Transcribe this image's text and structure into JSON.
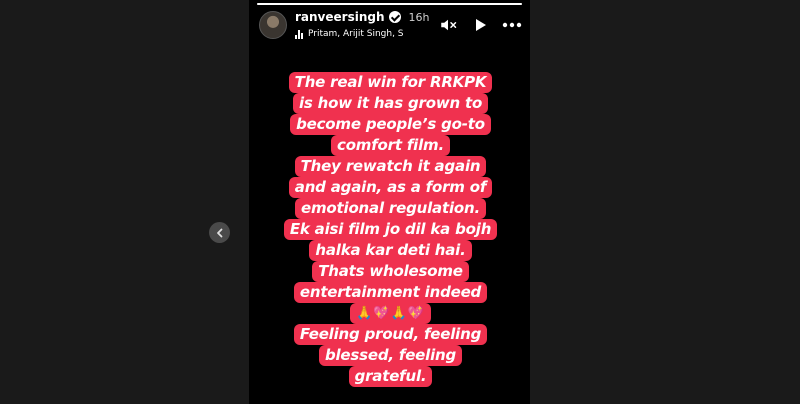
{
  "story": {
    "username": "ranveersingh",
    "time_ago": "16h",
    "music": "Pritam, Arijit Singh, S",
    "progress": 1.0,
    "text_lines": [
      "The real win for RRKPK",
      "is how it has grown to",
      "become people’s go-to",
      "comfort film.",
      "They rewatch it again",
      "and again, as a form of",
      "emotional regulation.",
      "Ek aisi film jo dil ka bojh",
      "halka kar deti hai.",
      "Thats wholesome",
      "entertainment indeed",
      "🙏💖🙏💖",
      "Feeling proud, feeling",
      "blessed, feeling",
      "grateful."
    ],
    "highlight_color": "#f0314f"
  },
  "icons": {
    "verified": "verified-badge-icon",
    "mute": "mute-icon",
    "play": "play-icon",
    "more": "more-options-icon",
    "prev": "chevron-left-icon",
    "music": "music-bars-icon"
  }
}
